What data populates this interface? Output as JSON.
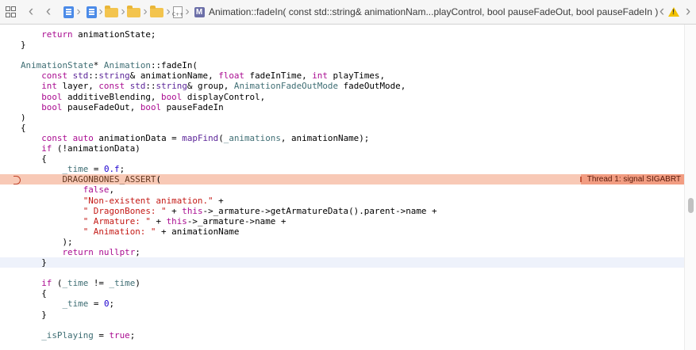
{
  "jumpbar": {
    "method_signature": "Animation::fadeIn( const std::string& animationNam...playControl, bool pauseFadeOut, bool pauseFadeIn )",
    "icons": [
      "related-items-icon",
      "back-arrow-icon",
      "forward-arrow-icon",
      "project-icon",
      "project-icon",
      "folder-icon",
      "folder-icon",
      "folder-icon",
      "cpp-file-icon",
      "method-icon",
      "issue-prev-icon",
      "warning-icon",
      "issue-next-icon"
    ],
    "method_badge": "M",
    "file_badge": "C++"
  },
  "editor": {
    "error_annotation": "Thread 1: signal SIGABRT",
    "colors": {
      "keyword": "#aa0d91",
      "type": "#5c2699",
      "class": "#3f6e74",
      "number": "#1c00cf",
      "string": "#c41a16",
      "error_line": "#f8c9b6",
      "annotation": "#f29d82"
    },
    "lines": [
      [
        [
          "    ",
          ""
        ],
        [
          "return",
          "kw"
        ],
        [
          " animationState;",
          ""
        ]
      ],
      [
        [
          "}",
          ""
        ]
      ],
      [
        [
          "",
          ""
        ]
      ],
      [
        [
          "AnimationState",
          "cl"
        ],
        [
          "* ",
          ""
        ],
        [
          "Animation",
          "cl"
        ],
        [
          "::fadeIn(",
          ""
        ]
      ],
      [
        [
          "    ",
          ""
        ],
        [
          "const",
          "kw"
        ],
        [
          " ",
          ""
        ],
        [
          "std",
          "ty"
        ],
        [
          "::",
          ""
        ],
        [
          "string",
          "ty"
        ],
        [
          "& animationName, ",
          ""
        ],
        [
          "float",
          "kw"
        ],
        [
          " fadeInTime, ",
          ""
        ],
        [
          "int",
          "kw"
        ],
        [
          " playTimes,",
          ""
        ]
      ],
      [
        [
          "    ",
          ""
        ],
        [
          "int",
          "kw"
        ],
        [
          " layer, ",
          ""
        ],
        [
          "const",
          "kw"
        ],
        [
          " ",
          ""
        ],
        [
          "std",
          "ty"
        ],
        [
          "::",
          ""
        ],
        [
          "string",
          "ty"
        ],
        [
          "& group, ",
          ""
        ],
        [
          "AnimationFadeOutMode",
          "cl"
        ],
        [
          " fadeOutMode,",
          ""
        ]
      ],
      [
        [
          "    ",
          ""
        ],
        [
          "bool",
          "kw"
        ],
        [
          " additiveBlending, ",
          ""
        ],
        [
          "bool",
          "kw"
        ],
        [
          " displayControl,",
          ""
        ]
      ],
      [
        [
          "    ",
          ""
        ],
        [
          "bool",
          "kw"
        ],
        [
          " pauseFadeOut, ",
          ""
        ],
        [
          "bool",
          "kw"
        ],
        [
          " pauseFadeIn",
          ""
        ]
      ],
      [
        [
          ")",
          ""
        ]
      ],
      [
        [
          "{",
          ""
        ]
      ],
      [
        [
          "    ",
          ""
        ],
        [
          "const",
          "kw"
        ],
        [
          " ",
          ""
        ],
        [
          "auto",
          "kw"
        ],
        [
          " animationData = ",
          ""
        ],
        [
          "mapFind",
          "ty"
        ],
        [
          "(",
          ""
        ],
        [
          "_animations",
          "cl"
        ],
        [
          ", animationName);",
          ""
        ]
      ],
      [
        [
          "    ",
          ""
        ],
        [
          "if",
          "kw"
        ],
        [
          " (!animationData)",
          ""
        ]
      ],
      [
        [
          "    {",
          ""
        ]
      ],
      [
        [
          "        ",
          ""
        ],
        [
          "_time",
          "cl"
        ],
        [
          " = ",
          ""
        ],
        [
          "0.f",
          "num"
        ],
        [
          ";",
          ""
        ]
      ],
      [
        [
          "        ",
          ""
        ],
        [
          "DRAGONBONES_ASSERT",
          "mac"
        ],
        [
          "(",
          ""
        ]
      ],
      [
        [
          "            ",
          ""
        ],
        [
          "false",
          "kw"
        ],
        [
          ",",
          ""
        ]
      ],
      [
        [
          "            ",
          ""
        ],
        [
          "\"Non-existent animation.\"",
          "str"
        ],
        [
          " +",
          ""
        ]
      ],
      [
        [
          "            ",
          ""
        ],
        [
          "\" DragonBones: \"",
          "str"
        ],
        [
          " + ",
          ""
        ],
        [
          "this",
          "kw"
        ],
        [
          "->_armature->getArmatureData().parent->name +",
          ""
        ]
      ],
      [
        [
          "            ",
          ""
        ],
        [
          "\" Armature: \"",
          "str"
        ],
        [
          " + ",
          ""
        ],
        [
          "this",
          "kw"
        ],
        [
          "->_armature->name +",
          ""
        ]
      ],
      [
        [
          "            ",
          ""
        ],
        [
          "\" Animation: \"",
          "str"
        ],
        [
          " + animationName",
          ""
        ]
      ],
      [
        [
          "        );",
          ""
        ]
      ],
      [
        [
          "        ",
          ""
        ],
        [
          "return",
          "kw"
        ],
        [
          " ",
          ""
        ],
        [
          "nullptr",
          "kw"
        ],
        [
          ";",
          ""
        ]
      ],
      [
        [
          "    }",
          ""
        ]
      ],
      [
        [
          "",
          ""
        ]
      ],
      [
        [
          "    ",
          ""
        ],
        [
          "if",
          "kw"
        ],
        [
          " (",
          ""
        ],
        [
          "_time",
          "cl"
        ],
        [
          " != ",
          ""
        ],
        [
          "_time",
          "cl"
        ],
        [
          ")",
          ""
        ]
      ],
      [
        [
          "    {",
          ""
        ]
      ],
      [
        [
          "        ",
          ""
        ],
        [
          "_time",
          "cl"
        ],
        [
          " = ",
          ""
        ],
        [
          "0",
          "num"
        ],
        [
          ";",
          ""
        ]
      ],
      [
        [
          "    }",
          ""
        ]
      ],
      [
        [
          "",
          ""
        ]
      ],
      [
        [
          "    ",
          ""
        ],
        [
          "_isPlaying",
          "cl"
        ],
        [
          " = ",
          ""
        ],
        [
          "true",
          "kw"
        ],
        [
          ";",
          ""
        ]
      ]
    ],
    "error_line_index": 14,
    "current_line_index": 22
  }
}
